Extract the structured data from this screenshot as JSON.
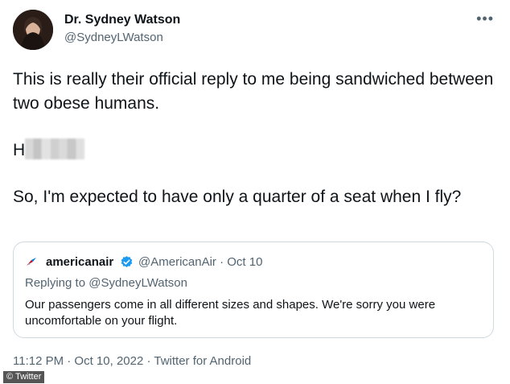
{
  "author": {
    "name": "Dr. Sydney Watson",
    "handle": "@SydneyLWatson"
  },
  "more_icon": "more-horizontal-icon",
  "tweet": {
    "line1": "This is really their official reply to me being sandwiched between two obese humans.",
    "line2_visible": "H",
    "line3": "So, I'm expected to have only a quarter of a seat when I fly?"
  },
  "quote": {
    "name": "americanair",
    "meta": "@AmericanAir · Oct 10",
    "replying_to": "Replying to @SydneyLWatson",
    "text": "Our passengers come in all different sizes and shapes. We're sorry you were uncomfortable on your flight.",
    "verified_color": "#1d9bf0"
  },
  "footer": "11:12 PM · Oct 10, 2022 · Twitter for Android",
  "credit": "© Twitter"
}
